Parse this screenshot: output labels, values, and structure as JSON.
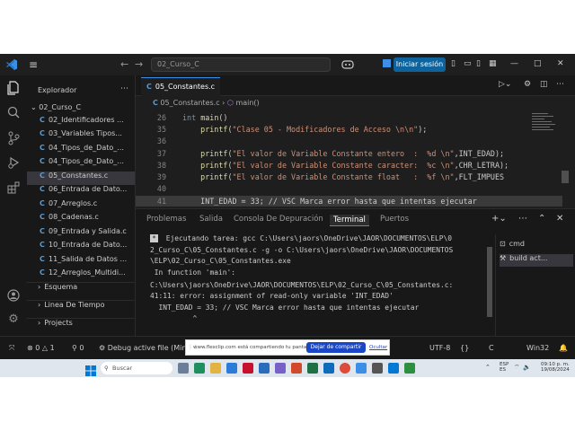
{
  "titlebar": {
    "menu_icon": "hamburger-icon",
    "search_text": "02_Curso_C",
    "signin_label": "Iniciar sesión",
    "colors": {
      "signin": "#0e639c",
      "logo": "#3c8ee6"
    }
  },
  "activity_bar": [
    "explorer-icon",
    "search-icon",
    "source-control-icon",
    "run-debug-icon",
    "extensions-icon",
    "account-icon",
    "settings-icon"
  ],
  "sidebar": {
    "title": "Explorador",
    "folder": "02_Curso_C",
    "items": [
      {
        "label": "02_Identificadores ..."
      },
      {
        "label": "03_Variables Tipos..."
      },
      {
        "label": "04_Tipos_de_Dato_..."
      },
      {
        "label": "04_Tipos_de_Dato_..."
      },
      {
        "label": "05_Constantes.c"
      },
      {
        "label": "06_Entrada de Dato..."
      },
      {
        "label": "07_Arreglos.c"
      },
      {
        "label": "08_Cadenas.c"
      },
      {
        "label": "09_Entrada y Salida.c"
      },
      {
        "label": "10_Entrada de Dato..."
      },
      {
        "label": "11_Salida de Datos ..."
      },
      {
        "label": "12_Arreglos_Multidi..."
      }
    ],
    "sections": [
      "Esquema",
      "Linea De Tiempo",
      "Projects"
    ]
  },
  "editor": {
    "tab_label": "05_Constantes.c",
    "breadcrumb_file": "05_Constantes.c",
    "breadcrumb_symbol": "main()",
    "lines": [
      {
        "n": "26",
        "pre": "",
        "kw": "int",
        "mid": " ",
        "fn": "main",
        "rest": "()",
        "str": "",
        "tail": ""
      },
      {
        "n": "35",
        "pre": "    ",
        "kw": "",
        "mid": "",
        "fn": "printf",
        "rest": "(",
        "str": "\"Clase 05 - Modificadores de Acceso \\n\\n\"",
        "tail": ");"
      },
      {
        "n": "36",
        "pre": "",
        "kw": "",
        "mid": "",
        "fn": "",
        "rest": "",
        "str": "",
        "tail": ""
      },
      {
        "n": "37",
        "pre": "    ",
        "kw": "",
        "mid": "",
        "fn": "printf",
        "rest": "(",
        "str": "\"El valor de Variable Constante entero  :  %d \\n\"",
        "tail": ",INT_EDAD);"
      },
      {
        "n": "38",
        "pre": "    ",
        "kw": "",
        "mid": "",
        "fn": "printf",
        "rest": "(",
        "str": "\"El valor de Variable Constante caracter:  %c \\n\"",
        "tail": ",CHR_LETRA);"
      },
      {
        "n": "39",
        "pre": "    ",
        "kw": "",
        "mid": "",
        "fn": "printf",
        "rest": "(",
        "str": "\"El valor de Variable Constante float   :  %f \\n\"",
        "tail": ",FLT_IMPUES"
      },
      {
        "n": "40",
        "pre": "",
        "kw": "",
        "mid": "",
        "fn": "",
        "rest": "",
        "str": "",
        "tail": ""
      },
      {
        "n": "41",
        "pre": "    ",
        "kw": "",
        "mid": "",
        "fn": "",
        "rest": "INT_EDAD = 33; // VSC Marca error hasta que intentas ejecutar",
        "str": "",
        "tail": ""
      }
    ]
  },
  "panel": {
    "tabs": [
      "Problemas",
      "Salida",
      "Consola De Depuración",
      "Terminal",
      "Puertos"
    ],
    "active_tab": "Terminal",
    "terminal_lines": [
      " Ejecutando tarea: gcc C:\\Users\\jaors\\OneDrive\\JAOR\\DOCUMENTOS\\ELP\\0",
      "2_Curso_C\\05_Constantes.c -g -o C:\\Users\\jaors\\OneDrive\\JAOR\\DOCUMENTOS",
      "\\ELP\\02_Curso_C\\05_Constantes.exe",
      " In function 'main':",
      "C:\\Users\\jaors\\OneDrive\\JAOR\\DOCUMENTOS\\ELP\\02_Curso_C\\05_Constantes.c:",
      "41:11: error: assignment of read-only variable 'INT_EDAD'",
      "  INT_EDAD = 33; // VSC Marca error hasta que intentas ejecutar",
      "          ^"
    ],
    "terminal_list": [
      "cmd",
      "build act..."
    ]
  },
  "statusbar": {
    "errors": "0",
    "warnings": "1",
    "debug": "Debug active file (Min",
    "encoding": "UTF-8",
    "language": "C",
    "platform": "Win32"
  },
  "share_bar": {
    "text": "www.flexclip.com está compartiendo tu pantalla",
    "stop_label": "Dejar de compartir",
    "hide_label": "Ocultar"
  },
  "taskbar": {
    "search_label": "Buscar",
    "lang_top": "ESP",
    "lang_bottom": "ES",
    "time": "09:10 p. m.",
    "date": "19/08/2024"
  }
}
